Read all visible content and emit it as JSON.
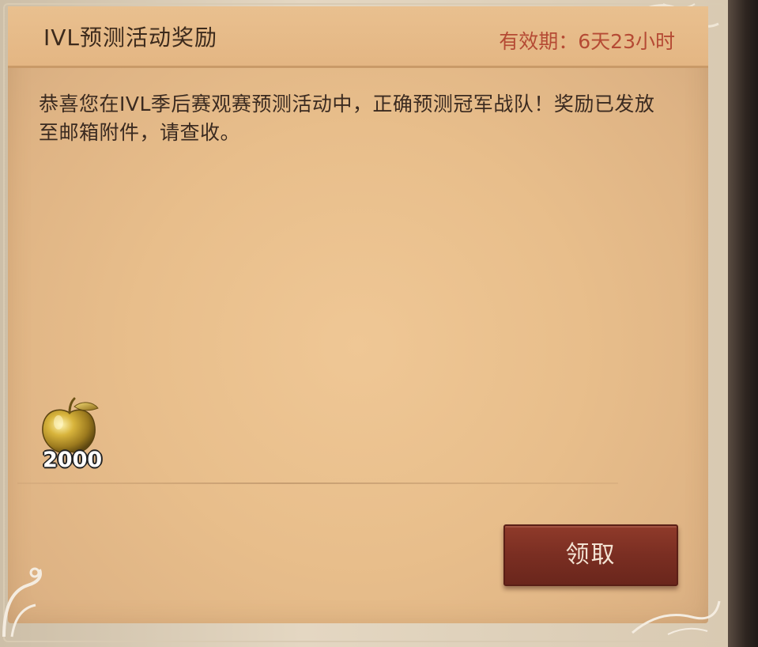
{
  "dialog": {
    "title": "IVL预测活动奖励",
    "validity": "有效期：6天23小时",
    "message": "恭喜您在IVL季后赛观赛预测活动中，正确预测冠军战队！奖励已发放至邮箱附件，请查收。"
  },
  "reward": {
    "icon": "golden-apple-icon",
    "count": "2000"
  },
  "actions": {
    "claim_label": "领取"
  },
  "colors": {
    "panel": "#e8be8b",
    "header": "#e4b683",
    "validity_text": "#b54a34",
    "button": "#7a2e22",
    "button_text": "#f3e3d3"
  }
}
